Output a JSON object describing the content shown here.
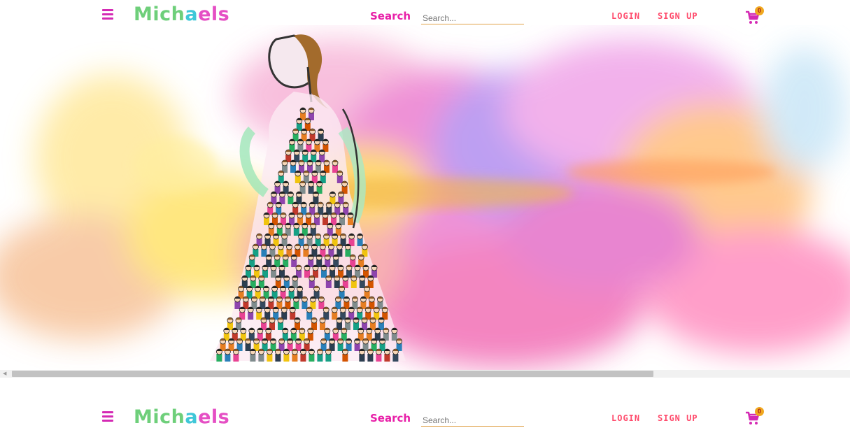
{
  "brand": {
    "logo_part1": "Mich",
    "logo_part2": "a",
    "logo_part3": "els"
  },
  "header": {
    "search_label": "Search",
    "search_placeholder": "Search...",
    "login_label": "LOGIN",
    "signup_label": "SIGN UP",
    "cart_count": "0"
  },
  "footer_nav": {
    "search_label": "Search",
    "search_placeholder": "Search...",
    "login_label": "LOGIN",
    "signup_label": "SIGN UP",
    "cart_count": "0"
  },
  "colors": {
    "accent": "#e81fa8",
    "link": "#ff4a6b",
    "badge": "#f0a81f"
  },
  "icons": {
    "menu": "hamburger-icon",
    "cart": "shopping-cart-icon"
  }
}
